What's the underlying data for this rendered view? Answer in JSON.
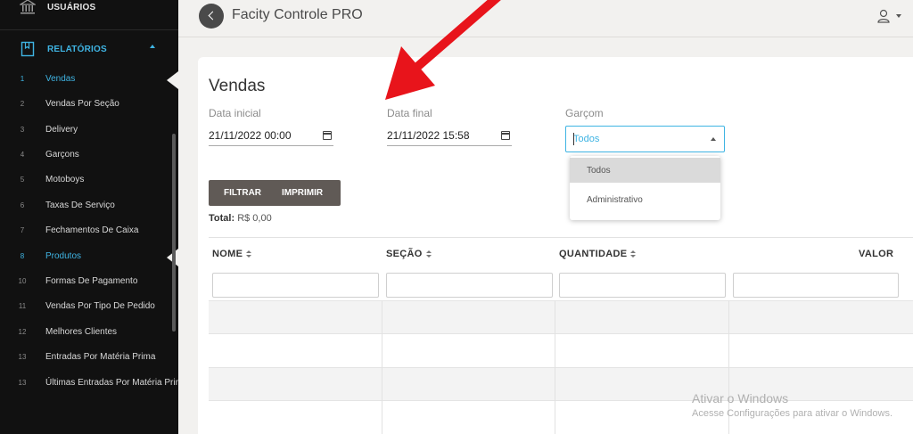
{
  "sidebar": {
    "users_label": "USUÁRIOS",
    "reports_label": "RELATÓRIOS",
    "items": [
      {
        "num": "1",
        "label": "Vendas",
        "active": true
      },
      {
        "num": "2",
        "label": "Vendas Por Seção"
      },
      {
        "num": "3",
        "label": "Delivery"
      },
      {
        "num": "4",
        "label": "Garçons"
      },
      {
        "num": "5",
        "label": "Motoboys"
      },
      {
        "num": "6",
        "label": "Taxas De Serviço"
      },
      {
        "num": "7",
        "label": "Fechamentos De Caixa"
      },
      {
        "num": "8",
        "label": "Produtos",
        "active": true
      },
      {
        "num": "10",
        "label": "Formas De Pagamento"
      },
      {
        "num": "11",
        "label": "Vendas Por Tipo De Pedido"
      },
      {
        "num": "12",
        "label": "Melhores Clientes"
      },
      {
        "num": "13",
        "label": "Entradas Por Matéria Prima"
      },
      {
        "num": "13",
        "label": "Últimas Entradas Por Matéria Prima"
      }
    ]
  },
  "header": {
    "title": "Facity Controle PRO"
  },
  "page": {
    "title": "Vendas",
    "start_label": "Data inicial",
    "start_value": "21/11/2022 00:00",
    "end_label": "Data final",
    "end_value": "21/11/2022 15:58",
    "waiter_label": "Garçom",
    "waiter_value": "Todos",
    "waiter_options": [
      "Todos",
      "Administrativo"
    ],
    "filter_button": "FILTRAR",
    "print_button": "IMPRIMIR",
    "total_label": "Total:",
    "total_value": "R$ 0,00"
  },
  "table": {
    "columns": [
      "NOME",
      "SEÇÃO",
      "QUANTIDADE",
      "VALOR"
    ]
  },
  "watermark": {
    "line1": "Ativar o Windows",
    "line2": "Acesse Configurações para ativar o Windows."
  },
  "colors": {
    "accent": "#3fb4e3",
    "sidebar_bg": "#111111",
    "arrow": "#e8141b"
  }
}
